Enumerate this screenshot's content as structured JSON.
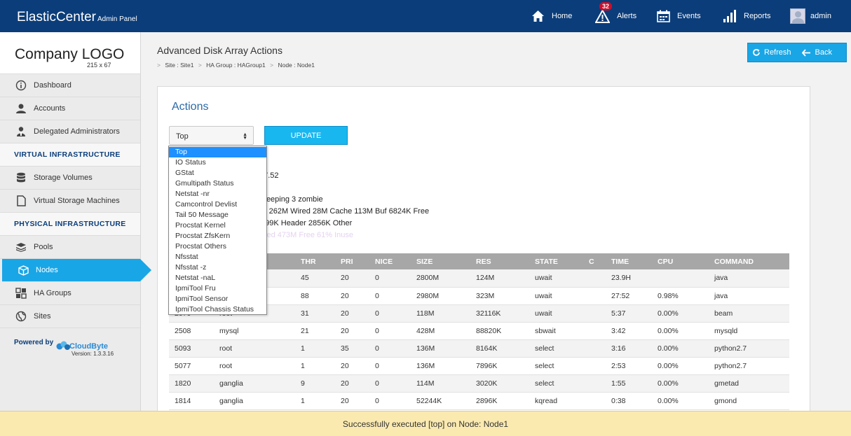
{
  "brand": {
    "title": "ElasticCenter",
    "subtitle": "Admin Panel"
  },
  "topnav": {
    "home": "Home",
    "alerts": "Alerts",
    "alerts_count": "32",
    "events": "Events",
    "reports": "Reports",
    "user": "admin"
  },
  "sidebar": {
    "logo_title": "Company LOGO",
    "logo_size": "215 x 67",
    "items": [
      {
        "label": "Dashboard"
      },
      {
        "label": "Accounts"
      },
      {
        "label": "Delegated Administrators"
      }
    ],
    "section_virtual": "VIRTUAL INFRASTRUCTURE",
    "virtual_items": [
      {
        "label": "Storage Volumes"
      },
      {
        "label": "Virtual Storage Machines"
      }
    ],
    "section_physical": "PHYSICAL INFRASTRUCTURE",
    "physical_items": [
      {
        "label": "Pools"
      },
      {
        "label": "Nodes"
      },
      {
        "label": "HA Groups"
      },
      {
        "label": "Sites"
      }
    ],
    "powered_by": "Powered by",
    "vendor": "CloudByte",
    "version": "Version: 1.3.3.16"
  },
  "page": {
    "title": "Advanced Disk Array Actions",
    "breadcrumb": [
      "Site : Site1",
      "HA Group : HAGroup1",
      "Node : Node1"
    ],
    "sep": ">",
    "refresh": "Refresh",
    "back": "Back"
  },
  "actions": {
    "title": "Actions",
    "selected": "Top",
    "update_label": "UPDATE",
    "options": [
      "Top",
      "IO Status",
      "GStat",
      "Gmultipath Status",
      "Netstat -nr",
      "Camcontrol Devlist",
      "Tail 50 Message",
      "Procstat Kernel",
      "Procstat ZfsKern",
      "Procstat Others",
      "Nfsstat",
      "Nfsstat -z",
      "Netstat -naL",
      "IpmiTool Fru",
      "IpmiTool Sensor",
      "IpmiTool Chassis Status"
    ]
  },
  "output": {
    "line1": "17.52",
    "line2": "sleeping 3 zombie",
    "line3": "ct 262M Wired 28M Cache 113M Buf 6824K Free",
    "line4": "599K Header 2856K Other",
    "line5": "sed 473M Free 61% Inuse"
  },
  "table": {
    "headers": [
      "",
      "",
      "THR",
      "PRI",
      "NICE",
      "SIZE",
      "RES",
      "STATE",
      "C",
      "TIME",
      "CPU",
      "COMMAND"
    ],
    "rows": [
      [
        "",
        "",
        "45",
        "20",
        "0",
        "2800M",
        "124M",
        "uwait",
        "",
        "23.9H",
        "",
        "java"
      ],
      [
        "",
        "",
        "88",
        "20",
        "0",
        "2980M",
        "323M",
        "uwait",
        "",
        "27:52",
        "0.98%",
        "java"
      ],
      [
        "2070",
        "root",
        "31",
        "20",
        "0",
        "118M",
        "32116K",
        "uwait",
        "",
        "5:37",
        "0.00%",
        "beam"
      ],
      [
        "2508",
        "mysql",
        "21",
        "20",
        "0",
        "428M",
        "88820K",
        "sbwait",
        "",
        "3:42",
        "0.00%",
        "mysqld"
      ],
      [
        "5093",
        "root",
        "1",
        "35",
        "0",
        "136M",
        "8164K",
        "select",
        "",
        "3:16",
        "0.00%",
        "python2.7"
      ],
      [
        "5077",
        "root",
        "1",
        "20",
        "0",
        "136M",
        "7896K",
        "select",
        "",
        "2:53",
        "0.00%",
        "python2.7"
      ],
      [
        "1820",
        "ganglia",
        "9",
        "20",
        "0",
        "114M",
        "3020K",
        "select",
        "",
        "1:55",
        "0.00%",
        "gmetad"
      ],
      [
        "1814",
        "ganglia",
        "1",
        "20",
        "0",
        "52244K",
        "2896K",
        "kqread",
        "",
        "0:38",
        "0.00%",
        "gmond"
      ]
    ]
  },
  "status": {
    "message": "Successfully executed [top] on Node: Node1"
  },
  "colors": {
    "topbar": "#0b3d7a",
    "accent": "#19a6e6",
    "status_bg": "#fbeab0"
  }
}
